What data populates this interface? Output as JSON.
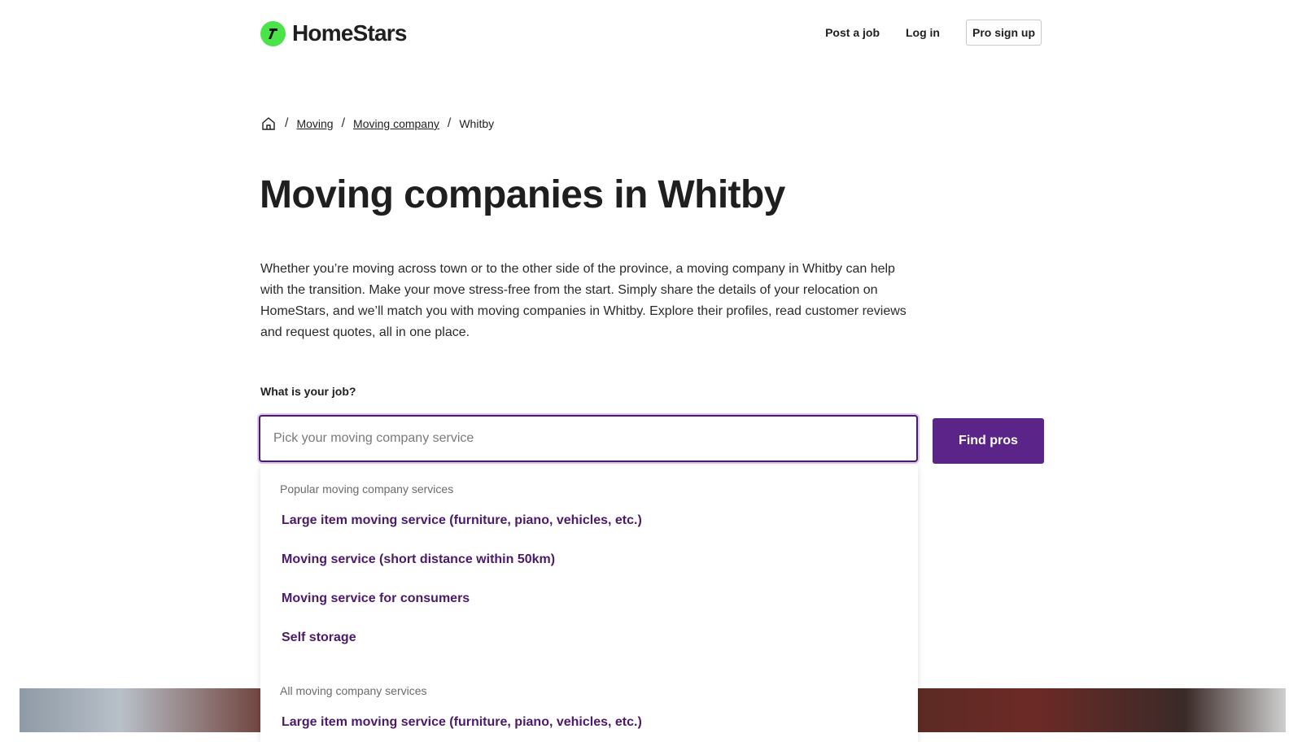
{
  "header": {
    "brand": "HomeStars",
    "nav": {
      "post_job": "Post a job",
      "log_in": "Log in",
      "pro_sign_up": "Pro sign up"
    }
  },
  "breadcrumb": {
    "home_icon": "home-icon",
    "items": [
      "Moving",
      "Moving company",
      "Whitby"
    ],
    "separator": "/"
  },
  "page": {
    "title": "Moving companies in Whitby",
    "intro": "Whether you’re moving across town or to the other side of the province, a moving company in Whitby can help with the transition. Make your move stress-free from the start. Simply share the details of your relocation on HomeStars, and we’ll match you with moving companies in Whitby. Explore their profiles, read customer reviews and request quotes, all in one place."
  },
  "search": {
    "label": "What is your job?",
    "placeholder": "Pick your moving company service",
    "value": "",
    "button": "Find pros"
  },
  "dropdown": {
    "popular_heading": "Popular moving company services",
    "popular": [
      "Large item moving service (furniture, piano, vehicles, etc.)",
      "Moving service (short distance within 50km)",
      "Moving service for consumers",
      "Self storage"
    ],
    "all_heading": "All moving company services",
    "all": [
      "Large item moving service (furniture, piano, vehicles, etc.)"
    ]
  },
  "colors": {
    "brand_green": "#4be34a",
    "accent_purple": "#5b2488",
    "link_purple": "#4b1a6b"
  }
}
